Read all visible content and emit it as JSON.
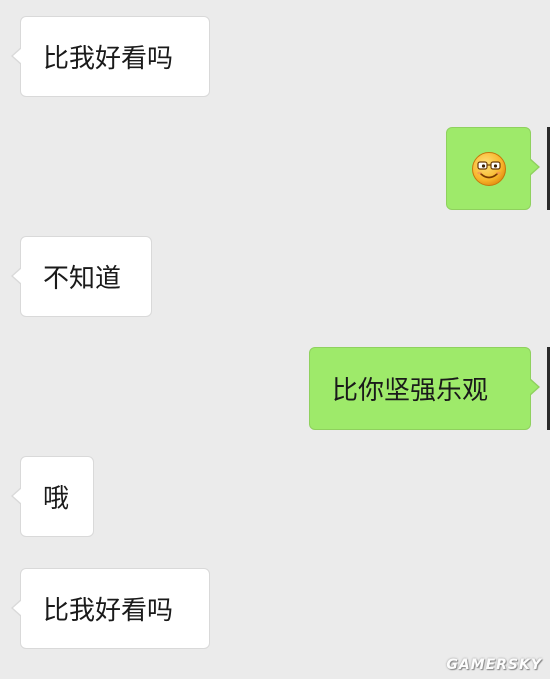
{
  "conversation": {
    "messages": [
      {
        "side": "incoming",
        "text": "比我好看吗"
      },
      {
        "side": "outgoing",
        "emoji": "smiling-with-glasses-emoji"
      },
      {
        "side": "incoming",
        "text": "不知道"
      },
      {
        "side": "outgoing",
        "text": "比你坚强乐观"
      },
      {
        "side": "incoming",
        "text": "哦"
      },
      {
        "side": "incoming",
        "text": "比我好看吗"
      }
    ]
  },
  "watermark": "GAMERSKY",
  "colors": {
    "background": "#ebebeb",
    "incoming_bubble": "#ffffff",
    "outgoing_bubble": "#9eea6a"
  }
}
